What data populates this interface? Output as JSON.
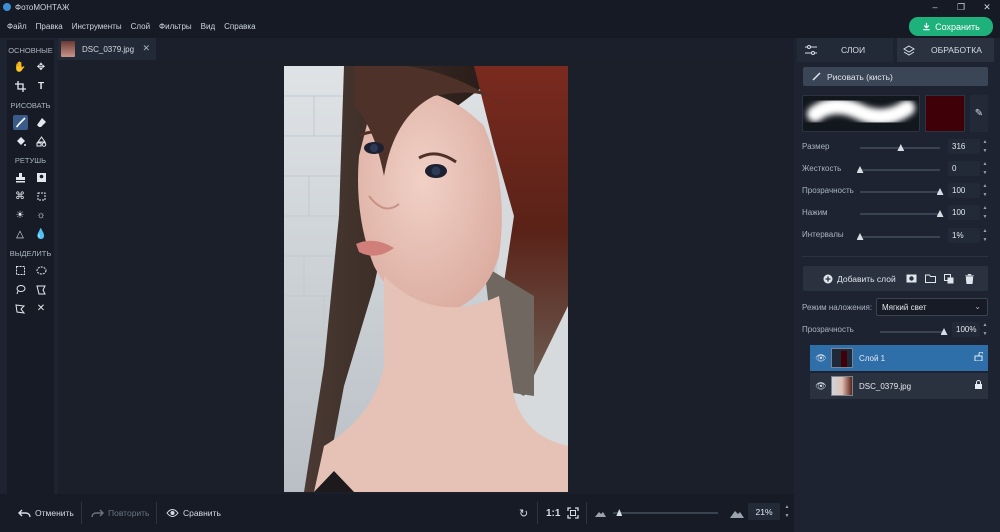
{
  "app": {
    "title": "ФотоМОНТАЖ"
  },
  "menu": [
    "Файл",
    "Правка",
    "Инструменты",
    "Слой",
    "Фильтры",
    "Вид",
    "Справка"
  ],
  "save_label": "Сохранить",
  "toolbox": {
    "sections": {
      "basic": "ОСНОВНЫЕ",
      "draw": "РИСОВАТЬ",
      "retouch": "РЕТУШЬ",
      "select": "ВЫДЕЛИТЬ"
    }
  },
  "document": {
    "tab_name": "DSC_0379.jpg"
  },
  "bottom": {
    "undo": "Отменить",
    "redo": "Повторить",
    "compare": "Сравнить",
    "actual_size": "1:1",
    "zoom": "21%",
    "zoom_level": 0.06
  },
  "right_panel": {
    "tabs": {
      "layers": "СЛОИ",
      "processing": "ОБРАБОТКА"
    },
    "brush_button": "Рисовать (кисть)",
    "brush_color": "#3f0008",
    "params": {
      "size": {
        "label": "Размер",
        "value": "316",
        "level": 0.51
      },
      "hardness": {
        "label": "Жесткость",
        "value": "0",
        "level": 0
      },
      "opacity": {
        "label": "Прозрачность",
        "value": "100",
        "level": 1
      },
      "pressure": {
        "label": "Нажим",
        "value": "100",
        "level": 1
      },
      "intervals": {
        "label": "Интервалы",
        "value": "1%",
        "level": 0
      }
    },
    "add_layer": "Добавить слой",
    "blend_label": "Режим наложения:",
    "blend_value": "Мягкий свет",
    "layer_opacity_label": "Прозрачность",
    "layer_opacity_value": "100%",
    "layer_opacity_level": 1,
    "layers": [
      {
        "name": "Слой 1",
        "selected": true
      },
      {
        "name": "DSC_0379.jpg",
        "selected": false
      }
    ]
  }
}
